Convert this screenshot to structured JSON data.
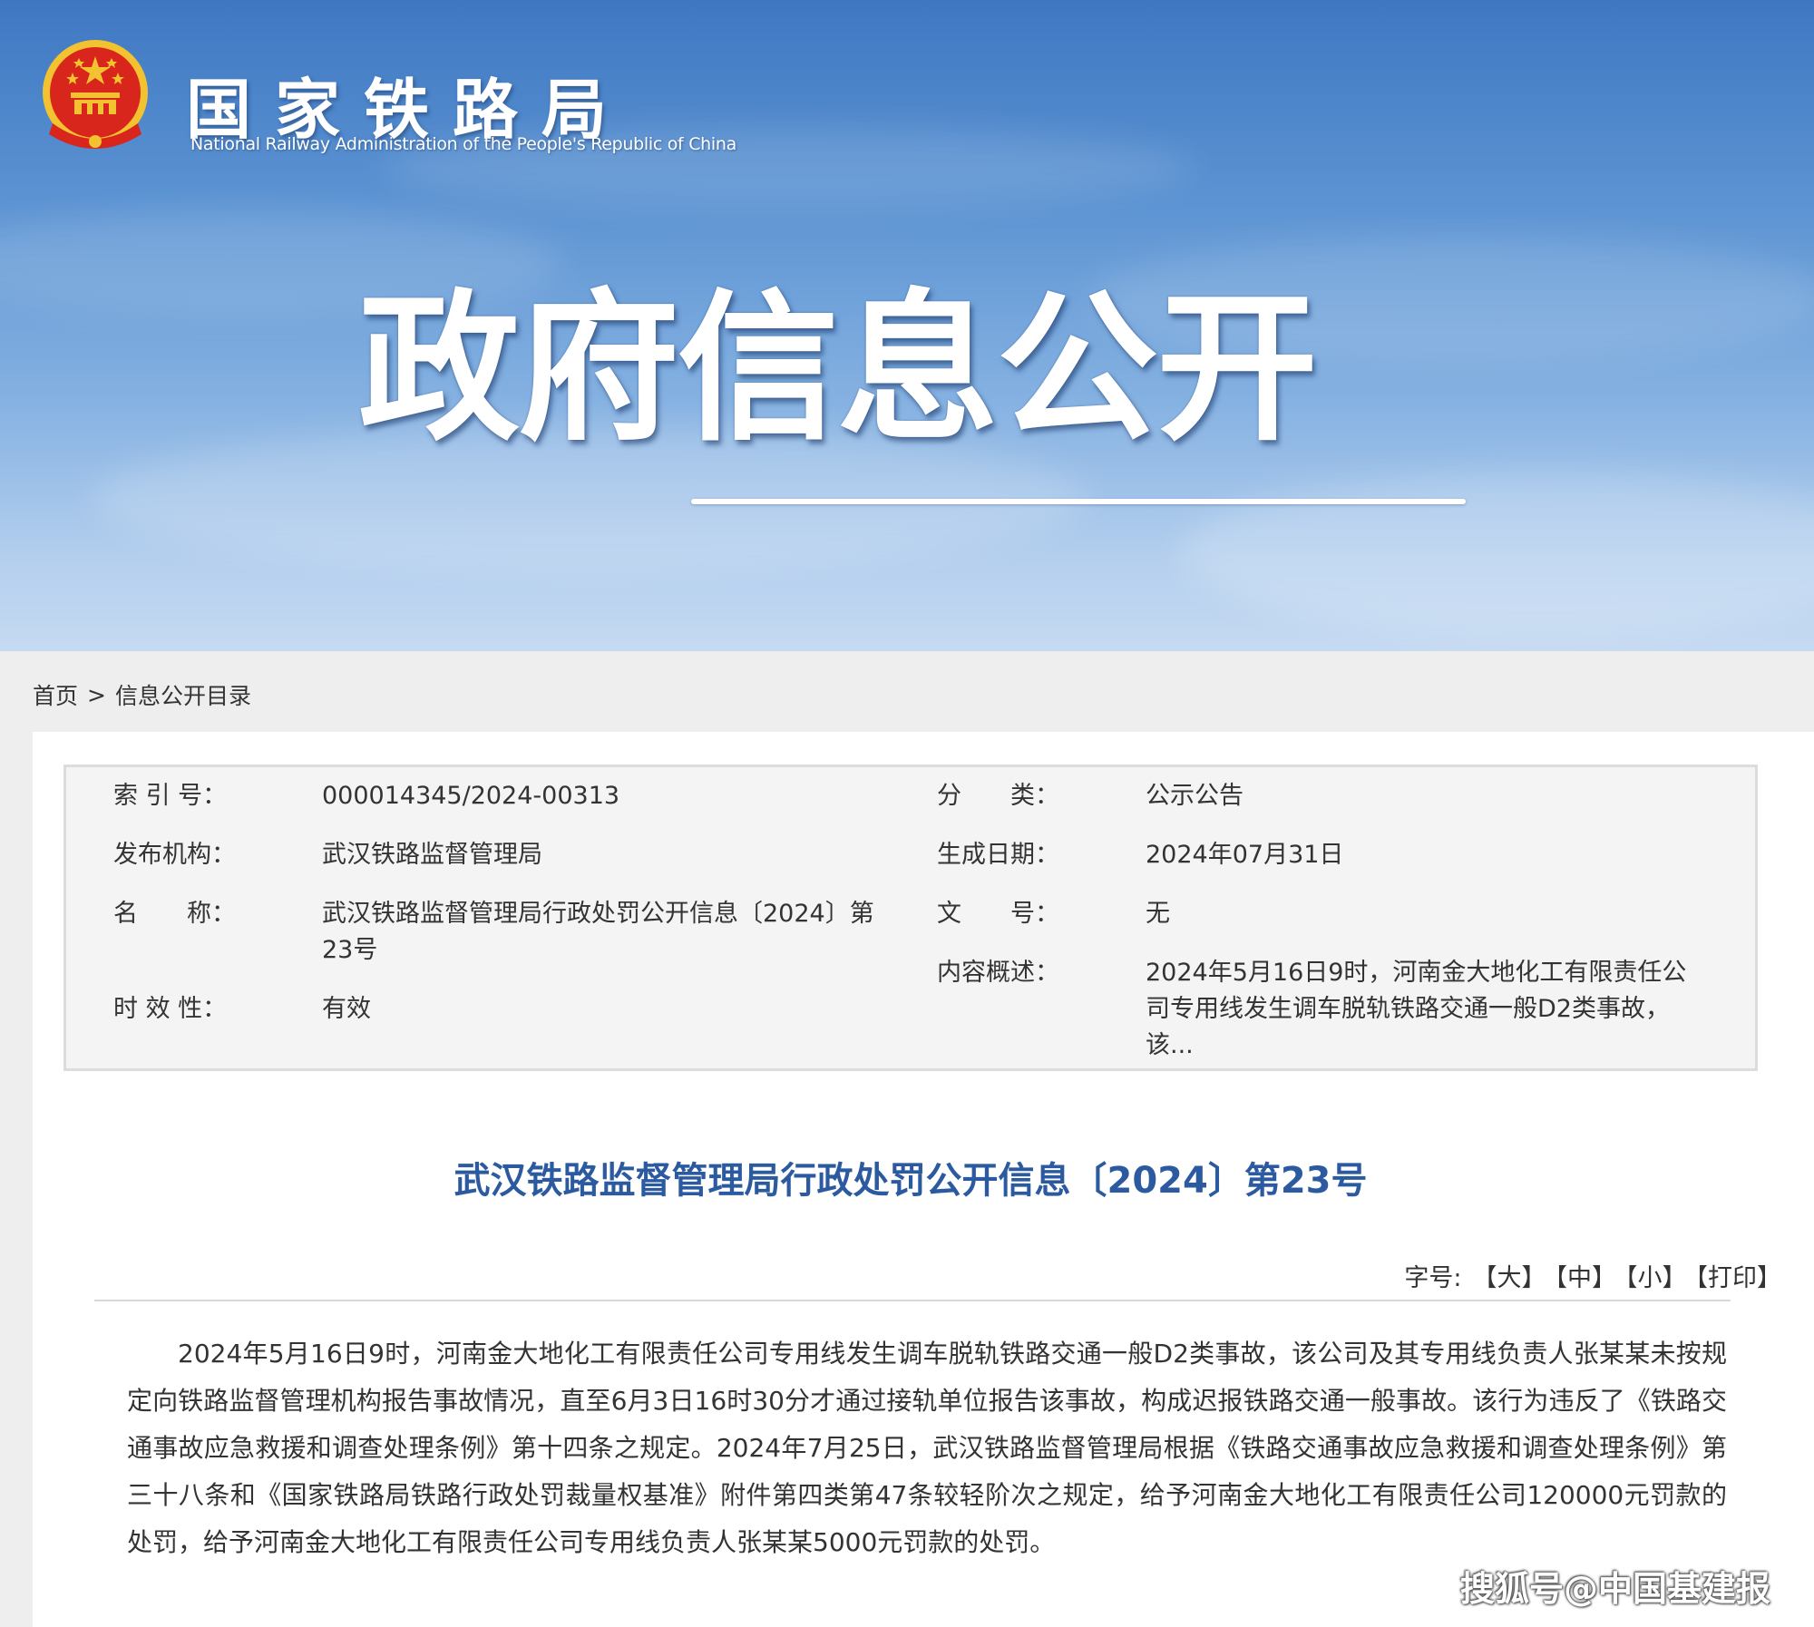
{
  "header": {
    "agency_cn": "国家铁路局",
    "agency_en": "National Railway Administration of the People's Republic of China",
    "banner_title": "政府信息公开"
  },
  "breadcrumb": {
    "home": "首页",
    "separator": ">",
    "current": "信息公开目录"
  },
  "info": {
    "index_label": "索 引 号：",
    "index_value": "000014345/2024-00313",
    "category_label": "分　　类：",
    "category_value": "公示公告",
    "publisher_label": "发布机构：",
    "publisher_value": "武汉铁路监督管理局",
    "date_label": "生成日期：",
    "date_value": "2024年07月31日",
    "name_label": "名　　称：",
    "name_value": "武汉铁路监督管理局行政处罚公开信息〔2024〕第23号",
    "docno_label": "文　　号：",
    "docno_value": "无",
    "summary_label": "内容概述：",
    "summary_value": "2024年5月16日9时，河南金大地化工有限责任公司专用线发生调车脱轨铁路交通一般D2类事故，该...",
    "validity_label": "时 效 性：",
    "validity_value": "有效"
  },
  "article": {
    "title": "武汉铁路监督管理局行政处罚公开信息〔2024〕第23号",
    "font_size_label": "字号:",
    "font_large": "【大】",
    "font_medium": "【中】",
    "font_small": "【小】",
    "print": "【打印】",
    "body": "2024年5月16日9时，河南金大地化工有限责任公司专用线发生调车脱轨铁路交通一般D2类事故，该公司及其专用线负责人张某某未按规定向铁路监督管理机构报告事故情况，直至6月3日16时30分才通过接轨单位报告该事故，构成迟报铁路交通一般事故。该行为违反了《铁路交通事故应急救援和调查处理条例》第十四条之规定。2024年7月25日，武汉铁路监督管理局根据《铁路交通事故应急救援和调查处理条例》第三十八条和《国家铁路局铁路行政处罚裁量权基准》附件第四类第47条较轻阶次之规定，给予河南金大地化工有限责任公司120000元罚款的处罚，给予河南金大地化工有限责任公司专用线负责人张某某5000元罚款的处罚。"
  },
  "watermark": "搜狐号@中国基建报",
  "colors": {
    "banner_top": "#3f78c2",
    "banner_bottom": "#c5daf2",
    "title_blue": "#2c5aa0",
    "emblem_red": "#d9261c",
    "emblem_gold": "#f2c230"
  },
  "icons": {
    "emblem": "national-emblem-icon"
  }
}
